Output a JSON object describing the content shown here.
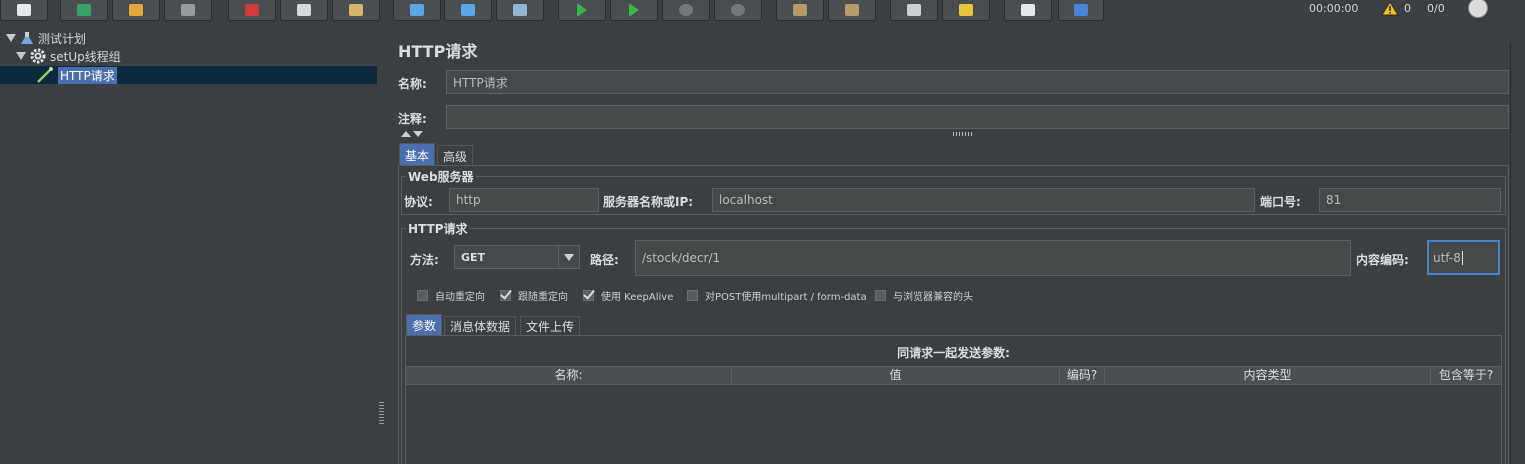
{
  "toolbar": {
    "buttons": [
      {
        "name": "new-icon",
        "color": "#e8e8e8"
      },
      {
        "name": "templates-icon",
        "color": "#3aa36b"
      },
      {
        "name": "open-icon",
        "color": "#e2a93b"
      },
      {
        "name": "save-icon",
        "color": "#9a9a9a"
      },
      {
        "name": "cut-icon",
        "color": "#d13b3b"
      },
      {
        "name": "copy-icon",
        "color": "#d8d8d8"
      },
      {
        "name": "paste-icon",
        "color": "#d9b56a"
      },
      {
        "name": "expand-icon",
        "color": "#5aa7e8"
      },
      {
        "name": "collapse-icon",
        "color": "#5aa7e8"
      },
      {
        "name": "toggle-icon",
        "color": "#8fb7d8"
      },
      {
        "name": "start-icon",
        "color": "#36b84a"
      },
      {
        "name": "start-no-pause-icon",
        "color": "#36b84a"
      },
      {
        "name": "stop-icon",
        "color": "#777777"
      },
      {
        "name": "shutdown-icon",
        "color": "#777777"
      },
      {
        "name": "clear-icon",
        "color": "#b89b6a"
      },
      {
        "name": "clear-all-icon",
        "color": "#b89b6a"
      },
      {
        "name": "search-icon",
        "color": "#cfcfcf"
      },
      {
        "name": "reset-search-icon",
        "color": "#e8c63a"
      },
      {
        "name": "function-helper-icon",
        "color": "#e8e8e8"
      },
      {
        "name": "help-icon",
        "color": "#4a86d8"
      }
    ],
    "timer": "00:00:00",
    "warning_count": "0",
    "thread_ratio": "0/0"
  },
  "tree": {
    "items": [
      {
        "label": "测试计划"
      },
      {
        "label": "setUp线程组"
      },
      {
        "label": "HTTP请求"
      }
    ]
  },
  "sampler": {
    "title": "HTTP请求",
    "name_label": "名称:",
    "name_value": "HTTP请求",
    "comment_label": "注释:",
    "comment_value": "",
    "tabs": [
      "基本",
      "高级"
    ],
    "web_server": {
      "title": "Web服务器",
      "protocol_label": "协议:",
      "protocol_value": "http",
      "server_label": "服务器名称或IP:",
      "server_value": "localhost",
      "port_label": "端口号:",
      "port_value": "81"
    },
    "http_request": {
      "title": "HTTP请求",
      "method_label": "方法:",
      "method_value": "GET",
      "path_label": "路径:",
      "path_value": "/stock/decr/1",
      "encoding_label": "内容编码:",
      "encoding_value": "utf-8"
    },
    "options": [
      {
        "label": "自动重定向",
        "checked": false
      },
      {
        "label": "跟随重定向",
        "checked": true
      },
      {
        "label": "使用 KeepAlive",
        "checked": true
      },
      {
        "label": "对POST使用multipart / form-data",
        "checked": false
      },
      {
        "label": "与浏览器兼容的头",
        "checked": false
      }
    ],
    "sub_tabs": [
      "参数",
      "消息体数据",
      "文件上传"
    ],
    "params": {
      "caption": "同请求一起发送参数:",
      "columns": [
        "名称:",
        "值",
        "编码?",
        "内容类型",
        "包含等于?"
      ]
    }
  }
}
